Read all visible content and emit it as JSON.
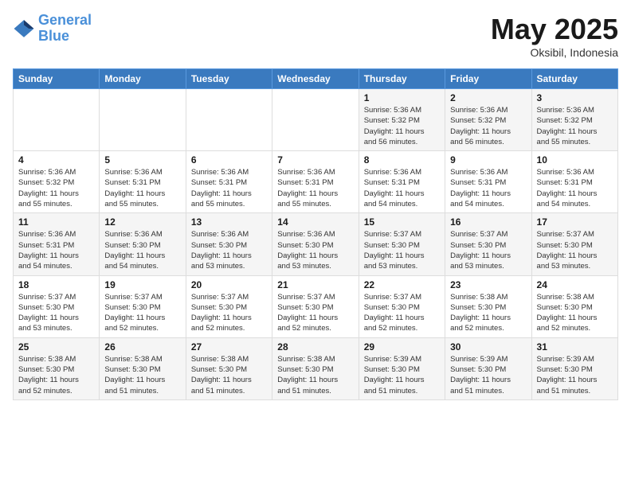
{
  "header": {
    "logo_line1": "General",
    "logo_line2": "Blue",
    "month": "May 2025",
    "location": "Oksibil, Indonesia"
  },
  "weekdays": [
    "Sunday",
    "Monday",
    "Tuesday",
    "Wednesday",
    "Thursday",
    "Friday",
    "Saturday"
  ],
  "weeks": [
    [
      {
        "day": "",
        "info": ""
      },
      {
        "day": "",
        "info": ""
      },
      {
        "day": "",
        "info": ""
      },
      {
        "day": "",
        "info": ""
      },
      {
        "day": "1",
        "info": "Sunrise: 5:36 AM\nSunset: 5:32 PM\nDaylight: 11 hours\nand 56 minutes."
      },
      {
        "day": "2",
        "info": "Sunrise: 5:36 AM\nSunset: 5:32 PM\nDaylight: 11 hours\nand 56 minutes."
      },
      {
        "day": "3",
        "info": "Sunrise: 5:36 AM\nSunset: 5:32 PM\nDaylight: 11 hours\nand 55 minutes."
      }
    ],
    [
      {
        "day": "4",
        "info": "Sunrise: 5:36 AM\nSunset: 5:32 PM\nDaylight: 11 hours\nand 55 minutes."
      },
      {
        "day": "5",
        "info": "Sunrise: 5:36 AM\nSunset: 5:31 PM\nDaylight: 11 hours\nand 55 minutes."
      },
      {
        "day": "6",
        "info": "Sunrise: 5:36 AM\nSunset: 5:31 PM\nDaylight: 11 hours\nand 55 minutes."
      },
      {
        "day": "7",
        "info": "Sunrise: 5:36 AM\nSunset: 5:31 PM\nDaylight: 11 hours\nand 55 minutes."
      },
      {
        "day": "8",
        "info": "Sunrise: 5:36 AM\nSunset: 5:31 PM\nDaylight: 11 hours\nand 54 minutes."
      },
      {
        "day": "9",
        "info": "Sunrise: 5:36 AM\nSunset: 5:31 PM\nDaylight: 11 hours\nand 54 minutes."
      },
      {
        "day": "10",
        "info": "Sunrise: 5:36 AM\nSunset: 5:31 PM\nDaylight: 11 hours\nand 54 minutes."
      }
    ],
    [
      {
        "day": "11",
        "info": "Sunrise: 5:36 AM\nSunset: 5:31 PM\nDaylight: 11 hours\nand 54 minutes."
      },
      {
        "day": "12",
        "info": "Sunrise: 5:36 AM\nSunset: 5:30 PM\nDaylight: 11 hours\nand 54 minutes."
      },
      {
        "day": "13",
        "info": "Sunrise: 5:36 AM\nSunset: 5:30 PM\nDaylight: 11 hours\nand 53 minutes."
      },
      {
        "day": "14",
        "info": "Sunrise: 5:36 AM\nSunset: 5:30 PM\nDaylight: 11 hours\nand 53 minutes."
      },
      {
        "day": "15",
        "info": "Sunrise: 5:37 AM\nSunset: 5:30 PM\nDaylight: 11 hours\nand 53 minutes."
      },
      {
        "day": "16",
        "info": "Sunrise: 5:37 AM\nSunset: 5:30 PM\nDaylight: 11 hours\nand 53 minutes."
      },
      {
        "day": "17",
        "info": "Sunrise: 5:37 AM\nSunset: 5:30 PM\nDaylight: 11 hours\nand 53 minutes."
      }
    ],
    [
      {
        "day": "18",
        "info": "Sunrise: 5:37 AM\nSunset: 5:30 PM\nDaylight: 11 hours\nand 53 minutes."
      },
      {
        "day": "19",
        "info": "Sunrise: 5:37 AM\nSunset: 5:30 PM\nDaylight: 11 hours\nand 52 minutes."
      },
      {
        "day": "20",
        "info": "Sunrise: 5:37 AM\nSunset: 5:30 PM\nDaylight: 11 hours\nand 52 minutes."
      },
      {
        "day": "21",
        "info": "Sunrise: 5:37 AM\nSunset: 5:30 PM\nDaylight: 11 hours\nand 52 minutes."
      },
      {
        "day": "22",
        "info": "Sunrise: 5:37 AM\nSunset: 5:30 PM\nDaylight: 11 hours\nand 52 minutes."
      },
      {
        "day": "23",
        "info": "Sunrise: 5:38 AM\nSunset: 5:30 PM\nDaylight: 11 hours\nand 52 minutes."
      },
      {
        "day": "24",
        "info": "Sunrise: 5:38 AM\nSunset: 5:30 PM\nDaylight: 11 hours\nand 52 minutes."
      }
    ],
    [
      {
        "day": "25",
        "info": "Sunrise: 5:38 AM\nSunset: 5:30 PM\nDaylight: 11 hours\nand 52 minutes."
      },
      {
        "day": "26",
        "info": "Sunrise: 5:38 AM\nSunset: 5:30 PM\nDaylight: 11 hours\nand 51 minutes."
      },
      {
        "day": "27",
        "info": "Sunrise: 5:38 AM\nSunset: 5:30 PM\nDaylight: 11 hours\nand 51 minutes."
      },
      {
        "day": "28",
        "info": "Sunrise: 5:38 AM\nSunset: 5:30 PM\nDaylight: 11 hours\nand 51 minutes."
      },
      {
        "day": "29",
        "info": "Sunrise: 5:39 AM\nSunset: 5:30 PM\nDaylight: 11 hours\nand 51 minutes."
      },
      {
        "day": "30",
        "info": "Sunrise: 5:39 AM\nSunset: 5:30 PM\nDaylight: 11 hours\nand 51 minutes."
      },
      {
        "day": "31",
        "info": "Sunrise: 5:39 AM\nSunset: 5:30 PM\nDaylight: 11 hours\nand 51 minutes."
      }
    ]
  ]
}
